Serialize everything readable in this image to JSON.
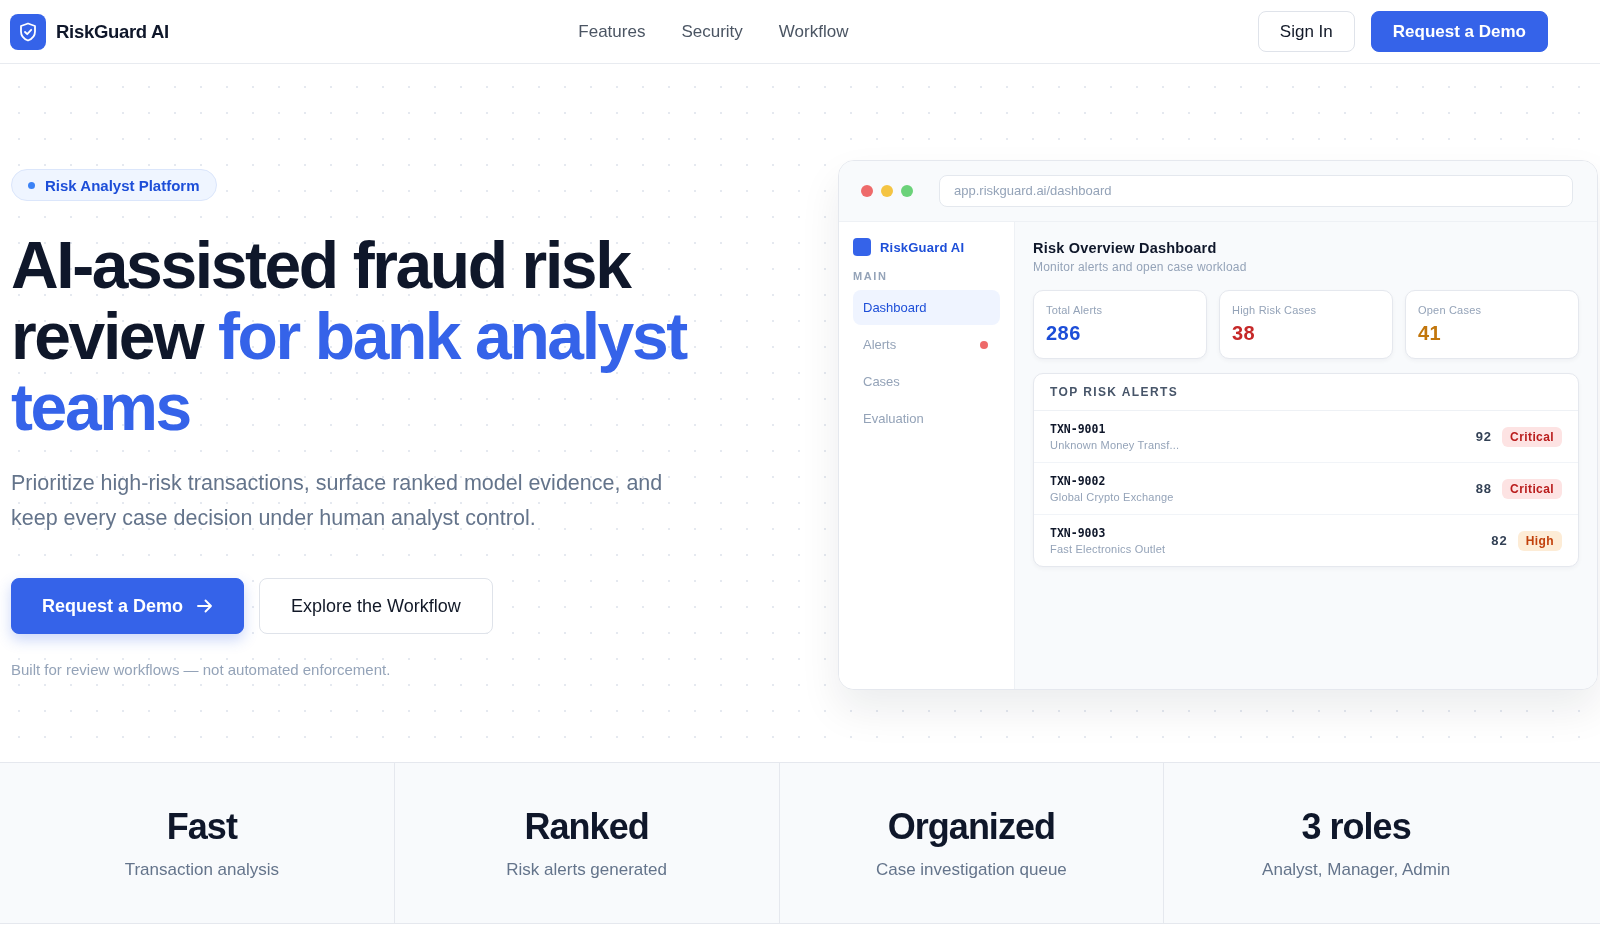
{
  "header": {
    "brand": "RiskGuard AI",
    "nav": [
      "Features",
      "Security",
      "Workflow"
    ],
    "actions": [
      {
        "label": "Sign In",
        "kind": "secondary"
      },
      {
        "label": "Request a Demo",
        "kind": "primary"
      }
    ]
  },
  "hero": {
    "badge": "Risk Analyst Platform",
    "headline": [
      {
        "text": "AI-assisted fraud risk review",
        "accent": false
      },
      {
        "text": "for bank analyst teams",
        "accent": true
      }
    ],
    "description": "Prioritize high-risk transactions, surface ranked model evidence, and keep every case decision under human analyst control.",
    "buttons": [
      {
        "label": "Request a Demo",
        "kind": "primary",
        "arrow": true
      },
      {
        "label": "Explore the Workflow",
        "kind": "secondary",
        "arrow": false
      }
    ],
    "footnote": "Built for review workflows — not automated enforcement."
  },
  "preview": {
    "url": "app.riskguard.ai/dashboard",
    "sidebar": {
      "brand": "RiskGuard AI",
      "section": "MAIN",
      "items": [
        {
          "label": "Dashboard",
          "selected": true,
          "has_alert": false
        },
        {
          "label": "Alerts",
          "selected": false,
          "has_alert": true
        },
        {
          "label": "Cases",
          "selected": false,
          "has_alert": false
        },
        {
          "label": "Evaluation",
          "selected": false,
          "has_alert": false
        }
      ]
    },
    "title": "Risk Overview Dashboard",
    "subtitle": "Monitor alerts and open case workload",
    "metrics": [
      {
        "label": "Total Alerts",
        "value": "286",
        "color": "#1d4ed8"
      },
      {
        "label": "High Risk Cases",
        "value": "38",
        "color": "#c62828"
      },
      {
        "label": "Open Cases",
        "value": "41",
        "color": "#c2760c"
      }
    ],
    "alerts": {
      "title": "TOP RISK ALERTS",
      "rows": [
        {
          "id": "TXN-9001",
          "merchant": "Unknown Money Transf...",
          "score": "92",
          "severity": "Critical",
          "kind": "critical"
        },
        {
          "id": "TXN-9002",
          "merchant": "Global Crypto Exchange",
          "score": "88",
          "severity": "Critical",
          "kind": "critical"
        },
        {
          "id": "TXN-9003",
          "merchant": "Fast Electronics Outlet",
          "score": "82",
          "severity": "High",
          "kind": "high"
        }
      ]
    }
  },
  "stats": [
    {
      "title": "Fast",
      "caption": "Transaction analysis"
    },
    {
      "title": "Ranked",
      "caption": "Risk alerts generated"
    },
    {
      "title": "Organized",
      "caption": "Case investigation queue"
    },
    {
      "title": "3 roles",
      "caption": "Analyst, Manager, Admin"
    }
  ]
}
